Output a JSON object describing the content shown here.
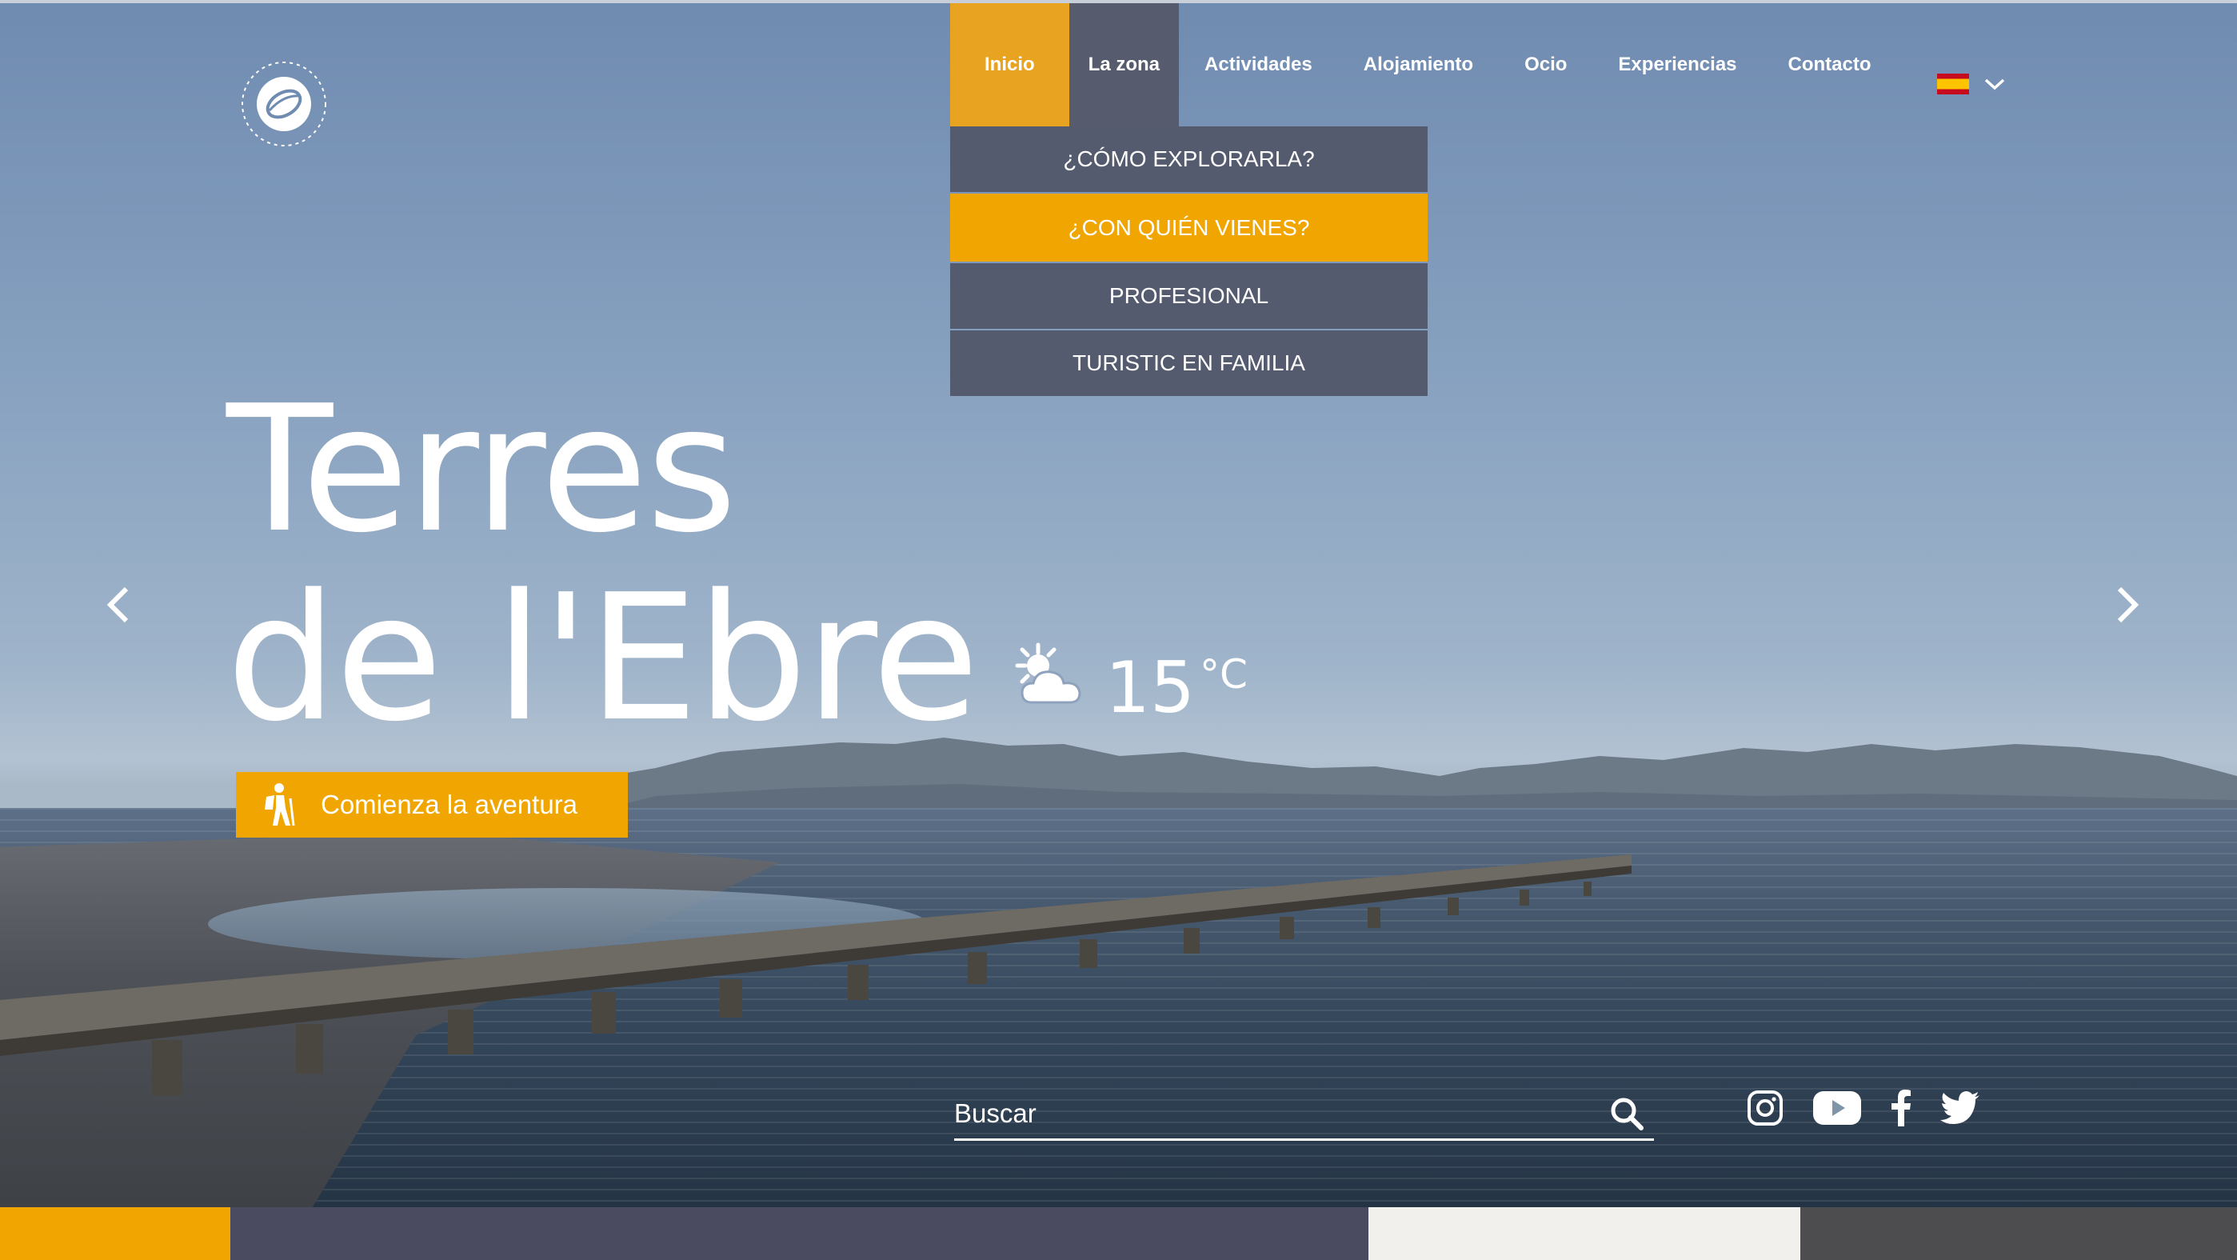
{
  "nav": {
    "items": [
      {
        "label": "Inicio"
      },
      {
        "label": "La zona"
      },
      {
        "label": "Actividades"
      },
      {
        "label": "Alojamiento"
      },
      {
        "label": "Ocio"
      },
      {
        "label": "Experiencias"
      },
      {
        "label": "Contacto"
      }
    ],
    "active_item": "Inicio",
    "open_item": "La zona"
  },
  "language": {
    "flag_icon": "spain-flag-icon",
    "chevron_icon": "chevron-down-icon"
  },
  "dropdown": {
    "items": [
      {
        "label": "¿CÓMO EXPLORARLA?"
      },
      {
        "label": "¿CON QUIÉN VIENES?"
      },
      {
        "label": "PROFESIONAL"
      },
      {
        "label": "TURISTIC EN FAMILIA"
      }
    ],
    "highlighted_item": "¿CON QUIÉN VIENES?"
  },
  "hero": {
    "title_line1": "Terres",
    "title_line2": "de l'Ebre",
    "weather": {
      "icon": "partly-cloudy-icon",
      "temperature": "15",
      "unit": "°C"
    },
    "cta_label": "Comienza la aventura",
    "cta_icon": "hiker-icon"
  },
  "search": {
    "placeholder": "Buscar",
    "icon": "search-icon"
  },
  "social": [
    "instagram-icon",
    "youtube-icon",
    "facebook-icon",
    "twitter-icon"
  ],
  "colors": {
    "accent": "#f0a500",
    "nav_active": "#e8a420",
    "nav_open": "#565b6d",
    "dropdown_bg": "#555b6e",
    "strip": [
      "#f0a500",
      "#4a4a60",
      "#f1f0ec",
      "#4d4d4f"
    ]
  }
}
